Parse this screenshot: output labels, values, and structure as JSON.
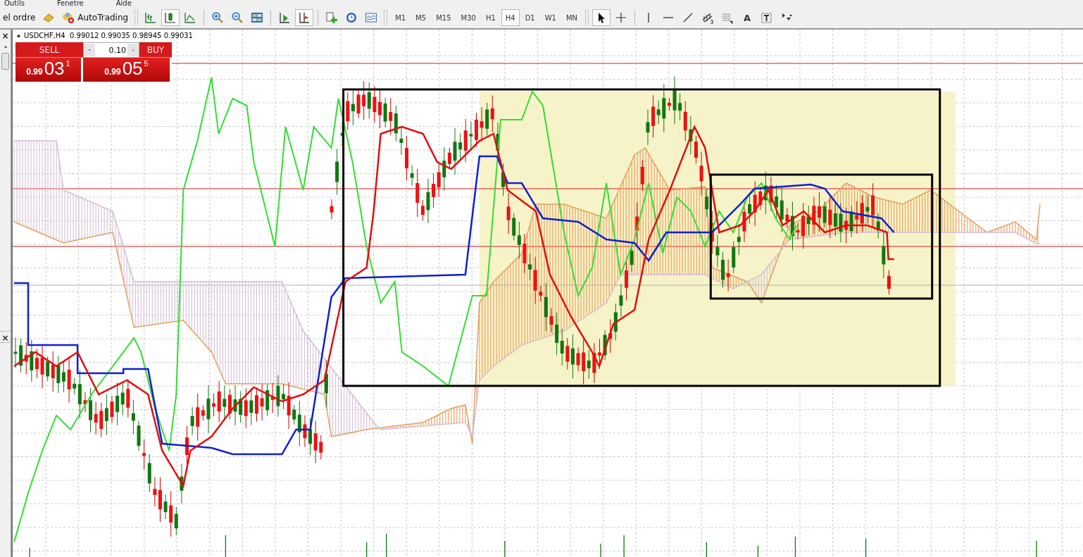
{
  "menu": [
    {
      "label": "Outils"
    },
    {
      "label": "Fenetre"
    },
    {
      "label": "Aide"
    }
  ],
  "toolbar": {
    "new_order": "el ordre",
    "autotrading": "AutoTrading",
    "chart_types": [
      {
        "kind": "bars",
        "selected": false
      },
      {
        "kind": "candles",
        "selected": true
      },
      {
        "kind": "line",
        "selected": false
      }
    ],
    "chart_toggles": [
      {
        "kind": "shift",
        "selected": false
      },
      {
        "kind": "autoscroll",
        "selected": true
      }
    ],
    "timeframes": [
      {
        "label": "M1",
        "selected": false
      },
      {
        "label": "M5",
        "selected": false
      },
      {
        "label": "M15",
        "selected": false
      },
      {
        "label": "M30",
        "selected": false
      },
      {
        "label": "H1",
        "selected": false
      },
      {
        "label": "H4",
        "selected": true
      },
      {
        "label": "D1",
        "selected": false
      },
      {
        "label": "W1",
        "selected": false
      },
      {
        "label": "MN",
        "selected": false
      }
    ],
    "tools": [
      {
        "kind": "cursor",
        "selected": true
      },
      {
        "kind": "crosshair",
        "selected": false
      },
      {
        "kind": "vline",
        "selected": false
      },
      {
        "kind": "hline",
        "selected": false
      },
      {
        "kind": "trendline",
        "selected": false
      },
      {
        "kind": "channel",
        "selected": false
      },
      {
        "kind": "fibo",
        "selected": false
      },
      {
        "kind": "text",
        "selected": false,
        "label": "A"
      },
      {
        "kind": "label",
        "selected": false
      },
      {
        "kind": "arrows",
        "selected": false
      }
    ]
  },
  "side_panels": [
    {
      "close": "×"
    },
    {
      "close": "×"
    }
  ],
  "chart": {
    "symbol_info": "USDCHF,H4  0.99012 0.99035 0.98945 0.99031",
    "trade_panel": {
      "sell": "SELL",
      "buy": "BUY",
      "volume": "0.10",
      "sell_price": {
        "prefix": "0.99",
        "big": "03",
        "sup": "1"
      },
      "buy_price": {
        "prefix": "0.99",
        "big": "05",
        "sup": "5"
      }
    }
  }
}
